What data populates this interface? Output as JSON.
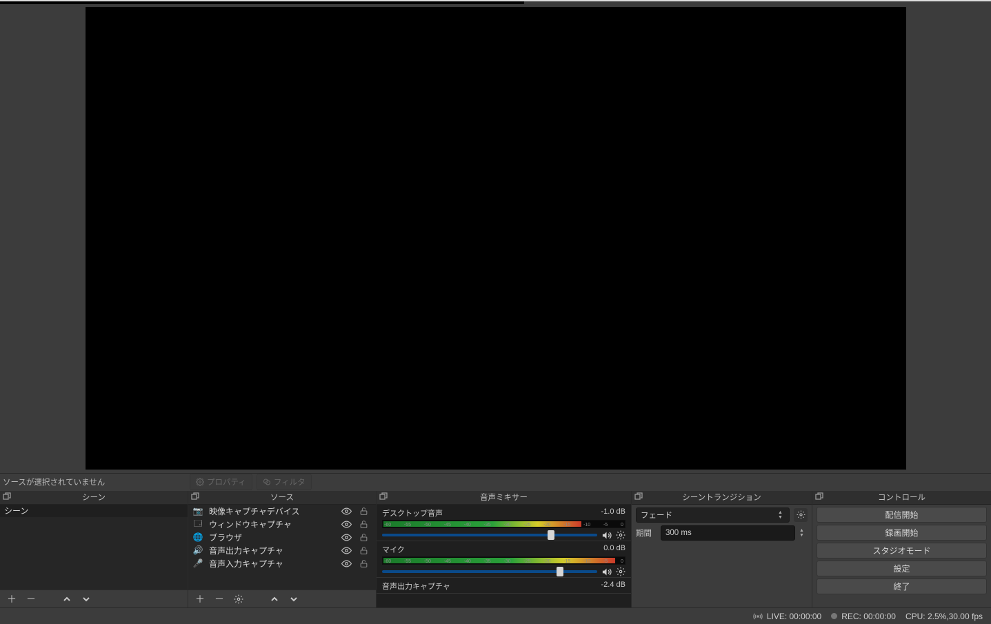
{
  "noSourceSelected": "ソースが選択されていません",
  "propertiesBtn": "プロパティ",
  "filtersBtn": "フィルタ",
  "panels": {
    "scenes": "シーン",
    "sources": "ソース",
    "mixer": "音声ミキサー",
    "transitions": "シーントランジション",
    "controls": "コントロール"
  },
  "scenes": [
    {
      "name": "シーン"
    }
  ],
  "sources": [
    {
      "icon": "camera",
      "label": "映像キャプチャデバイス"
    },
    {
      "icon": "window",
      "label": "ウィンドウキャプチャ"
    },
    {
      "icon": "globe",
      "label": "ブラウザ"
    },
    {
      "icon": "speaker",
      "label": "音声出力キャプチャ"
    },
    {
      "icon": "mic",
      "label": "音声入力キャプチャ"
    }
  ],
  "mixer": [
    {
      "name": "デスクトップ音声",
      "db": "-1.0 dB",
      "level": 82,
      "knob": 77
    },
    {
      "name": "マイク",
      "db": "0.0 dB",
      "level": 96,
      "knob": 81
    },
    {
      "name": "音声出力キャプチャ",
      "db": "-2.4 dB",
      "level": 0,
      "knob": 0
    }
  ],
  "mixerTicks": [
    "-60",
    "-55",
    "-50",
    "-45",
    "-40",
    "-35",
    "-30",
    "-25",
    "-20",
    "-15",
    "-10",
    "-5",
    "0"
  ],
  "transitions": {
    "selected": "フェード",
    "durationLabel": "期間",
    "durationValue": "300 ms"
  },
  "controls": [
    "配信開始",
    "録画開始",
    "スタジオモード",
    "設定",
    "終了"
  ],
  "status": {
    "live": "LIVE: 00:00:00",
    "rec": "REC: 00:00:00",
    "cpu": "CPU: 2.5%,30.00 fps"
  },
  "iconGlyphs": {
    "camera": "📷",
    "window": "🗔",
    "globe": "🌐",
    "speaker": "🔊",
    "mic": "🎤"
  }
}
